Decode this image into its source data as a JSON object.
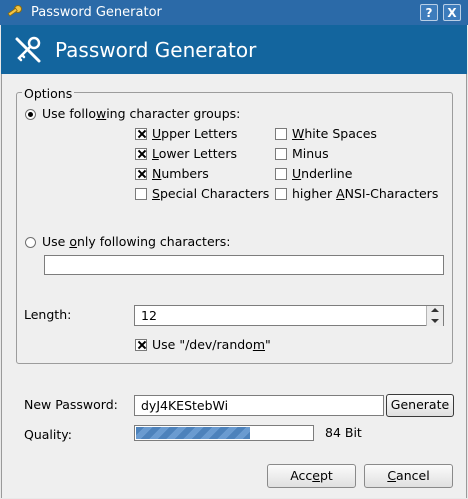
{
  "window": {
    "title": "Password Generator",
    "icon": "key-icon",
    "help_button": "?",
    "close_button": "X"
  },
  "banner": {
    "title": "Password Generator",
    "icon": "key-tools-icon"
  },
  "options": {
    "group_title": "Options",
    "mode_groups": {
      "label_pre": "Use follo",
      "label_u": "w",
      "label_post": "ing character groups:",
      "selected": true
    },
    "groups": [
      {
        "pre": "",
        "u": "U",
        "post": "pper Letters",
        "checked": true
      },
      {
        "pre": "",
        "u": "L",
        "post": "ower Letters",
        "checked": true
      },
      {
        "pre": "",
        "u": "N",
        "post": "umbers",
        "checked": true
      },
      {
        "pre": "",
        "u": "S",
        "post": "pecial Characters",
        "checked": false
      },
      {
        "pre": "",
        "u": "W",
        "post": "hite Spaces",
        "checked": false
      },
      {
        "pre": "Minus",
        "u": "",
        "post": "",
        "checked": false
      },
      {
        "pre": "",
        "u": "U",
        "post": "nderline",
        "checked": false
      },
      {
        "pre": "higher ",
        "u": "A",
        "post": "NSI-Characters",
        "checked": false
      }
    ],
    "mode_only": {
      "label_pre": "Use ",
      "label_u": "o",
      "label_post": "nly following characters:",
      "selected": false,
      "value": ""
    },
    "length": {
      "label": "Length:",
      "value": "12"
    },
    "dev_random": {
      "label_pre": "Use \"/dev/rando",
      "label_u": "m",
      "label_post": "\"",
      "checked": true
    }
  },
  "result": {
    "new_password_label": "New Password:",
    "password": "dyJ4KEStebWi",
    "generate_button": "Generate",
    "quality_label": "Quality:",
    "quality_fraction": 0.65,
    "quality_text": "84 Bit"
  },
  "buttons": {
    "accept_pre": "Acc",
    "accept_u": "e",
    "accept_post": "pt",
    "cancel_pre": "",
    "cancel_u": "C",
    "cancel_post": "ancel"
  },
  "colors": {
    "titlebar": "#2b6aa8",
    "banner": "#13659e",
    "progress": "#4d82bb"
  }
}
